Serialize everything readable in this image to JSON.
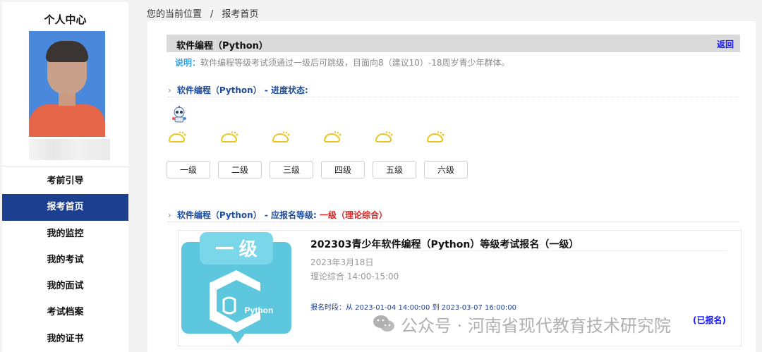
{
  "sidebar": {
    "title": "个人中心",
    "menu": [
      {
        "label": "考前引导",
        "active": false
      },
      {
        "label": "报考首页",
        "active": true
      },
      {
        "label": "我的监控",
        "active": false
      },
      {
        "label": "我的考试",
        "active": false
      },
      {
        "label": "我的面试",
        "active": false
      },
      {
        "label": "考试档案",
        "active": false
      },
      {
        "label": "我的证书",
        "active": false
      }
    ]
  },
  "breadcrumb": {
    "prefix": "您的当前位置",
    "separator": "/",
    "current": "报考首页"
  },
  "header": {
    "title": "软件编程（Python）",
    "back_label": "返回"
  },
  "description": {
    "label": "说明：",
    "text": "软件编程等级考试须通过一级后可跳级，目面向8（建议10）-18周岁青少年群体。"
  },
  "progress": {
    "heading": "软件编程（Python） - 进度状态:",
    "levels": [
      "一级",
      "二级",
      "三级",
      "四级",
      "五级",
      "六级"
    ]
  },
  "apply": {
    "heading": "软件编程（Python） - 应报名等级: ",
    "level": "一级（理论综合）"
  },
  "exam": {
    "cover_badge": "一 级",
    "cover_logo_text": "Python",
    "title": "202303青少年软件编程（Python）等级考试报名（一级）",
    "date": "2023年3月18日",
    "time": "理论综合 14:00-15:00",
    "period": "报名时段：从 2023-01-04 14:00:00 到 2023-03-07 16:00:00",
    "status_label": "(已报名)"
  },
  "watermark": {
    "text": "公众号 · 河南省现代教育技术研究院"
  },
  "colors": {
    "nav_active": "#1d3f8f",
    "accent_blue": "#1e4d9c",
    "link": "#1a1aff",
    "alert_red": "#e02020",
    "cover_cyan": "#5cc7dd"
  }
}
